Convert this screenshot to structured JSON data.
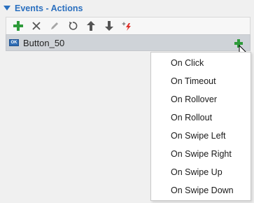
{
  "panel": {
    "title": "Events - Actions",
    "caret_icon": "triangle-down-icon"
  },
  "toolbar": {
    "buttons": [
      {
        "name": "add",
        "icon": "plus-icon",
        "color": "#2e9b3a"
      },
      {
        "name": "delete",
        "icon": "close-icon",
        "color": "#555555"
      },
      {
        "name": "edit",
        "icon": "pencil-icon",
        "color": "#9a9a9a"
      },
      {
        "name": "reset",
        "icon": "undo-icon",
        "color": "#555555"
      },
      {
        "name": "move-up",
        "icon": "arrow-up-icon",
        "color": "#555555"
      },
      {
        "name": "move-down",
        "icon": "arrow-down-icon",
        "color": "#555555"
      },
      {
        "name": "trigger",
        "icon": "sparkle-bolt-icon",
        "color": "#e0302a"
      }
    ]
  },
  "event_row": {
    "type_badge": "OK",
    "label": "Button_50",
    "add_icon": "plus-icon"
  },
  "menu": {
    "items": [
      "On Click",
      "On Timeout",
      "On Rollover",
      "On Rollout",
      "On Swipe Left",
      "On Swipe Right",
      "On Swipe Up",
      "On Swipe Down"
    ]
  },
  "colors": {
    "accent": "#2a6fbf",
    "add_green": "#2e9b3a",
    "row_bg": "#cfd3d8"
  }
}
